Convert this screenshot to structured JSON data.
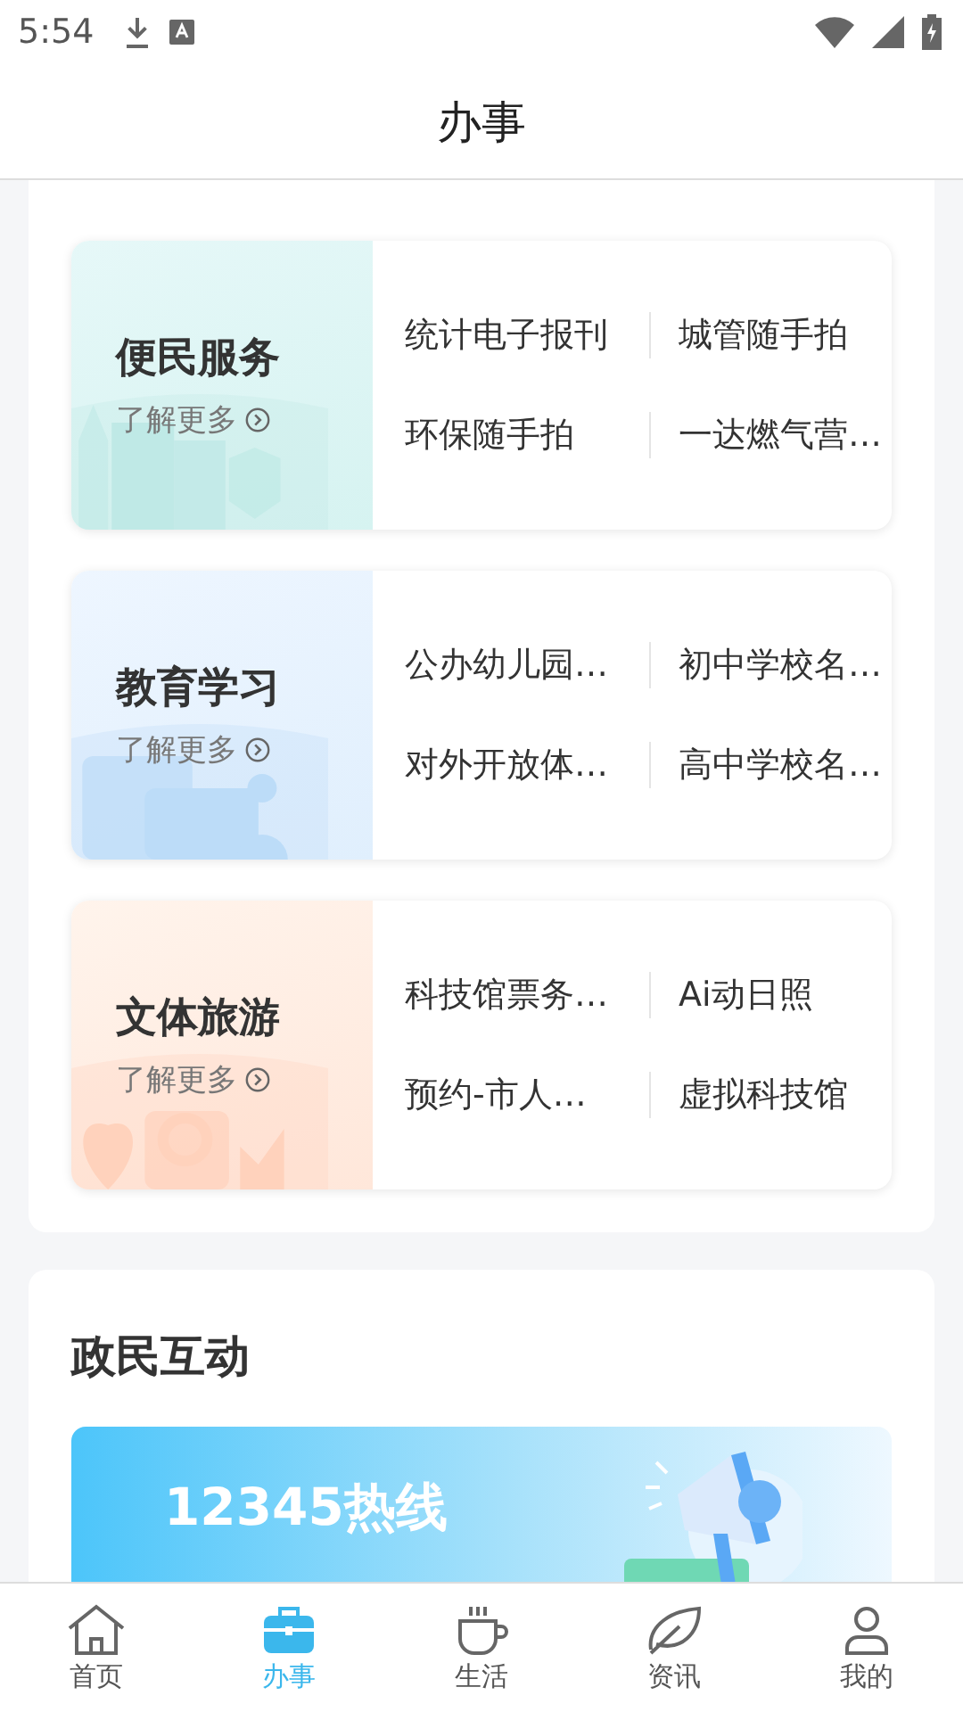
{
  "status_bar": {
    "time": "5:54"
  },
  "header": {
    "title": "办事"
  },
  "categories": [
    {
      "kind": "city",
      "title": "便民服务",
      "more": "了解更多",
      "services": [
        "统计电子报刊",
        "城管随手拍",
        "环保随手拍",
        "一达燃气营…"
      ]
    },
    {
      "kind": "education",
      "title": "教育学习",
      "more": "了解更多",
      "services": [
        "公办幼儿园…",
        "初中学校名…",
        "对外开放体…",
        "高中学校名…"
      ]
    },
    {
      "kind": "culture",
      "title": "文体旅游",
      "more": "了解更多",
      "services": [
        "科技馆票务…",
        "Ai动日照",
        "预约-市人…",
        "虚拟科技馆"
      ]
    }
  ],
  "interaction": {
    "title": "政民互动",
    "banner": {
      "title": "12345热线"
    }
  },
  "tab_bar": [
    {
      "kind": "home",
      "label": "首页",
      "selected": false
    },
    {
      "kind": "bag",
      "label": "办事",
      "selected": true
    },
    {
      "kind": "cup",
      "label": "生活",
      "selected": false
    },
    {
      "kind": "leaf",
      "label": "资讯",
      "selected": false
    },
    {
      "kind": "person",
      "label": "我的",
      "selected": false
    }
  ]
}
